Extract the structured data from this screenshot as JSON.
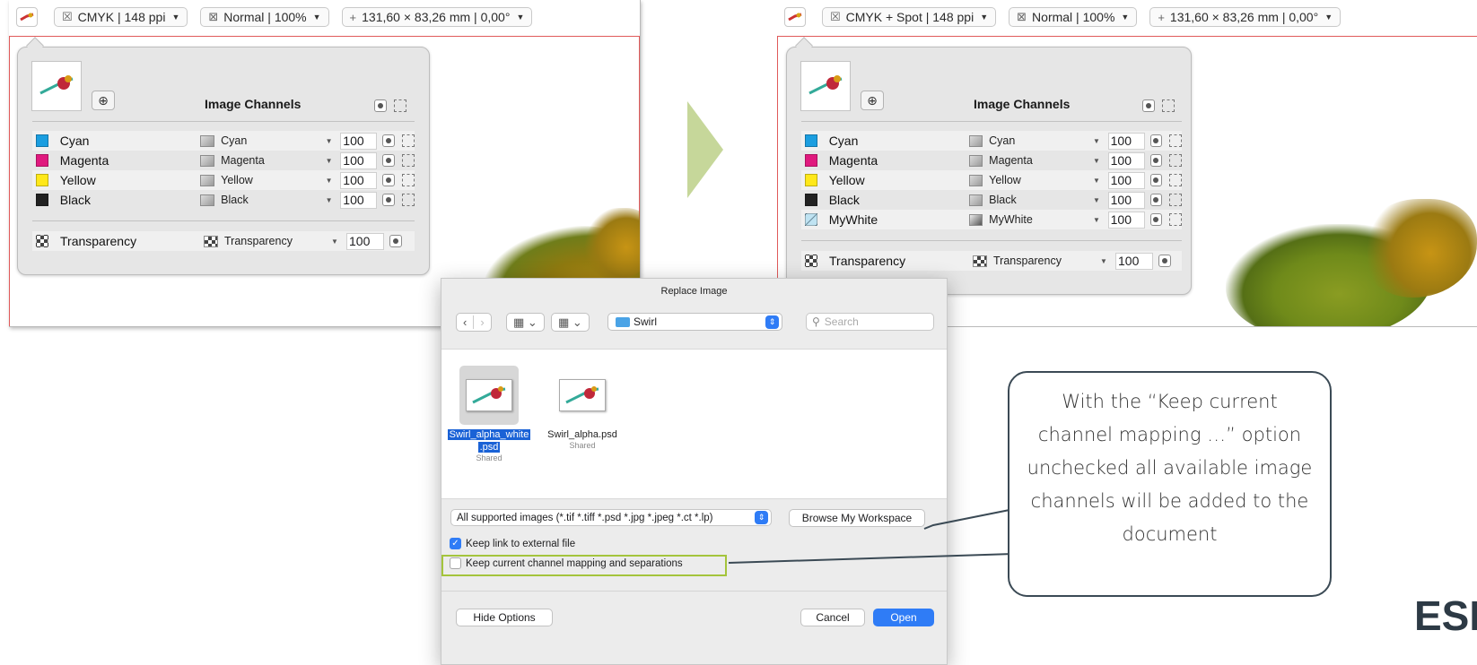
{
  "left_panel": {
    "toolbar": {
      "color": "CMYK | 148 ppi",
      "blend": "Normal | 100%",
      "dims": "131,60 × 83,26 mm | 0,00°"
    },
    "popover": {
      "title": "Image Channels",
      "channels": [
        {
          "name": "Cyan",
          "source": "Cyan",
          "value": "100",
          "color": "#1b9ee0"
        },
        {
          "name": "Magenta",
          "source": "Magenta",
          "value": "100",
          "color": "#e0197e"
        },
        {
          "name": "Yellow",
          "source": "Yellow",
          "value": "100",
          "color": "#ffe81a"
        },
        {
          "name": "Black",
          "source": "Black",
          "value": "100",
          "color": "#222222"
        }
      ],
      "transparency": {
        "name": "Transparency",
        "source": "Transparency",
        "value": "100"
      }
    }
  },
  "right_panel": {
    "toolbar": {
      "color": "CMYK + Spot | 148 ppi",
      "blend": "Normal | 100%",
      "dims": "131,60 × 83,26 mm | 0,00°"
    },
    "popover": {
      "title": "Image Channels",
      "channels": [
        {
          "name": "Cyan",
          "source": "Cyan",
          "value": "100",
          "color": "#1b9ee0"
        },
        {
          "name": "Magenta",
          "source": "Magenta",
          "value": "100",
          "color": "#e0197e"
        },
        {
          "name": "Yellow",
          "source": "Yellow",
          "value": "100",
          "color": "#ffe81a"
        },
        {
          "name": "Black",
          "source": "Black",
          "value": "100",
          "color": "#222222"
        },
        {
          "name": "MyWhite",
          "source": "MyWhite",
          "value": "100",
          "color": "#bfe3f2"
        }
      ],
      "transparency": {
        "name": "Transparency",
        "source": "Transparency",
        "value": "100"
      }
    }
  },
  "dialog": {
    "title": "Replace Image",
    "folder": "Swirl",
    "search_placeholder": "Search",
    "files": [
      {
        "name_line1": "Swirl_alpha_white",
        "name_line2": ".psd",
        "status": "Shared",
        "selected": true
      },
      {
        "name_line1": "Swirl_alpha.psd",
        "name_line2": "",
        "status": "Shared",
        "selected": false
      }
    ],
    "filter": "All supported images (*.tif *.tiff *.psd *.jpg *.jpeg *.ct *.lp)",
    "browse_label": "Browse My Workspace",
    "keep_link_label": "Keep link to external file",
    "keep_link_checked": true,
    "keep_mapping_label": "Keep current channel mapping and separations",
    "keep_mapping_checked": false,
    "hide_options_label": "Hide Options",
    "cancel_label": "Cancel",
    "open_label": "Open"
  },
  "callout": {
    "text": "With the “Keep current channel mapping …” option unchecked all available image channels will be added to the document"
  },
  "logo": "ESK",
  "colors": {
    "accent": "#2f7cf6",
    "highlight_box": "#a4c43c",
    "arrow": "#c6d79a",
    "frame_red": "#e05a5a"
  }
}
